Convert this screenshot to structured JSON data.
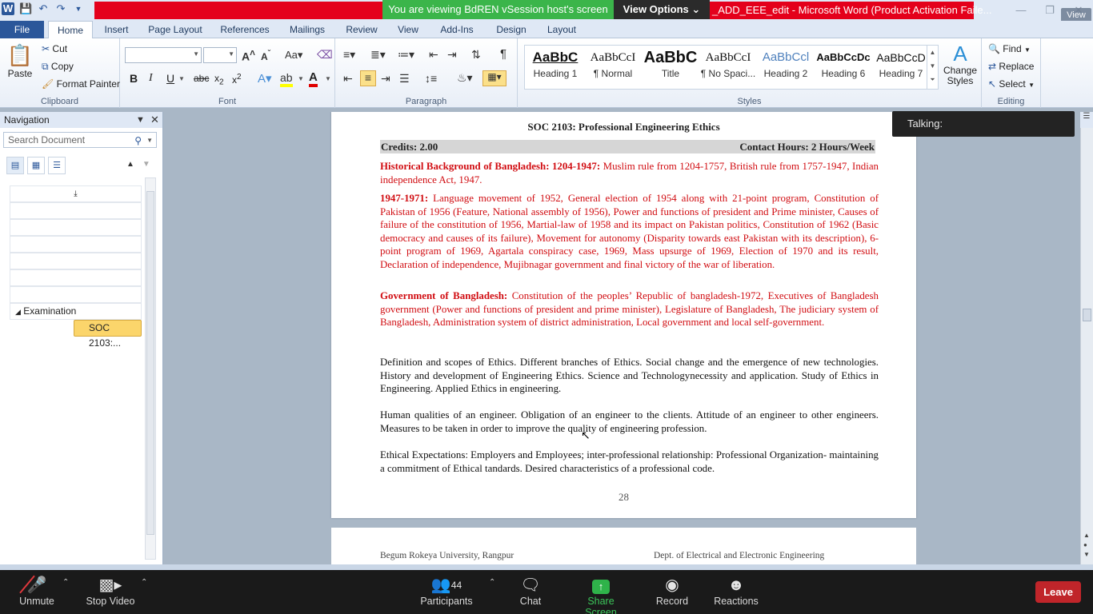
{
  "window": {
    "title": "_ADD_EEE_edit - Microsoft Word (Product Activation Faile...",
    "vsession_banner": "You are viewing BdREN vSession host's screen",
    "view_options": "View Options",
    "view_button": "View"
  },
  "ribbon_tabs": [
    "File",
    "Home",
    "Insert",
    "Page Layout",
    "References",
    "Mailings",
    "Review",
    "View",
    "Add-Ins",
    "Design",
    "Layout"
  ],
  "clipboard": {
    "label": "Clipboard",
    "paste": "Paste",
    "cut": "Cut",
    "copy": "Copy",
    "format_painter": "Format Painter"
  },
  "font": {
    "label": "Font",
    "name_value": "",
    "size_value": ""
  },
  "paragraph": {
    "label": "Paragraph"
  },
  "styles": {
    "label": "Styles",
    "items": [
      {
        "sample": "AaBbC",
        "name": "Heading 1"
      },
      {
        "sample": "AaBbCcI",
        "name": "¶ Normal"
      },
      {
        "sample": "AaBbC",
        "name": "Title"
      },
      {
        "sample": "AaBbCcI",
        "name": "¶ No Spaci..."
      },
      {
        "sample": "AaBbCcl",
        "name": "Heading 2"
      },
      {
        "sample": "AaBbCcDc",
        "name": "Heading 6"
      },
      {
        "sample": "AaBbCcD",
        "name": "Heading 7"
      }
    ],
    "change_styles": "Change Styles"
  },
  "editing": {
    "label": "Editing",
    "find": "Find",
    "replace": "Replace",
    "select": "Select"
  },
  "navigation": {
    "title": "Navigation",
    "search_placeholder": "Search Document",
    "heading_item": "Examination",
    "selected_item": "SOC 2103:..."
  },
  "document": {
    "course_title": "SOC 2103: Professional  Engineering Ethics",
    "credits": "Credits:  2.00",
    "contact_hours": "Contact Hours:  2 Hours/Week",
    "p1_head": "Historical Background of Bangladesh: 1204-1947:",
    "p1_text": " Muslim rule from 1204-1757, British rule from 1757-1947, Indian independence Act, 1947.",
    "p2_head": " 1947-1971:",
    "p2_text": " Language movement of 1952, General election of 1954 along with 21-point program, Constitution of Pakistan of 1956 (Feature, National assembly of 1956), Power and functions of president and Prime minister, Causes of failure of the constitution of 1956, Martial-law of 1958 and its impact on Pakistan politics, Constitution of 1962 (Basic democracy and causes of its failure), Movement for autonomy (Disparity towards east Pakistan with its description), 6-point program of 1969,  Agartala  conspiracy case, 1969, Mass upsurge of 1969, Election of 1970 and its result, Declaration of independence,  Mujibnagar government and final victory of the war of liberation.",
    "p3_head": "Government of Bangladesh:",
    "p3_text": " Constitution of the peoples’ Republic of bangladesh-1972, Executives of Bangladesh government (Power and functions of president and prime minister), Legislature of Bangladesh, The judiciary system of Bangladesh, Administration system of district administration, Local government and local self-government.",
    "p4_text": "Definition and scopes of Ethics. Different branches of Ethics. Social change and  the  emergence  of  new technologies.  History  and development  of  Engineering  Ethics.  Science  and  Technologynecessity  and application.  Study  of  Ethics  in  Engineering.  Applied Ethics in engineering.",
    "p5_text": "Human  qualities  of  an  engineer.  Obligation  of  an  engineer  to  the clients.  Attitude  of  an  engineer  to other  engineers.  Measures  to  be taken in order to improve the quality of engineering profession.",
    "p6_text": "Ethical  Expectations:  Employers  and  Employees;  inter-professional relationship: Professional Organization- maintaining a commitment of Ethical  tandards.  Desired  characteristics  of  a  professional  code.",
    "page_number": "28",
    "footer_left": "Begum Rokeya University, Rangpur",
    "footer_right": "Dept. of Electrical  and Electronic Engineering"
  },
  "talking_label": "Talking:",
  "meeting": {
    "unmute": "Unmute",
    "stop_video": "Stop Video",
    "participants": "Participants",
    "participants_count": "44",
    "chat": "Chat",
    "share_screen": "Share Screen",
    "record": "Record",
    "reactions": "Reactions",
    "leave": "Leave"
  }
}
